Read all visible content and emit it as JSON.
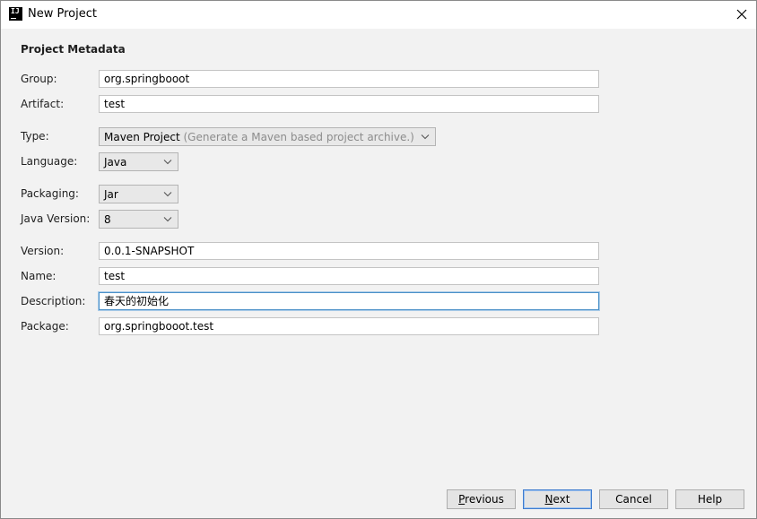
{
  "window": {
    "title": "New Project",
    "app_icon_text": "IJ"
  },
  "form": {
    "section_title": "Project Metadata",
    "group": {
      "label": "Group:",
      "value": "org.springbooot"
    },
    "artifact": {
      "label": "Artifact:",
      "value": "test"
    },
    "type": {
      "label": "Type:",
      "value": "Maven Project",
      "hint": "(Generate a Maven based project archive.)"
    },
    "language": {
      "label": "Language:",
      "value": "Java"
    },
    "packaging": {
      "label": "Packaging:",
      "value": "Jar"
    },
    "java_version": {
      "label": "Java Version:",
      "value": "8"
    },
    "version": {
      "label": "Version:",
      "value": "0.0.1-SNAPSHOT"
    },
    "name": {
      "label": "Name:",
      "value": "test"
    },
    "description": {
      "label": "Description:",
      "value": "春天的初始化"
    },
    "package": {
      "label": "Package:",
      "value": "org.springbooot.test"
    }
  },
  "buttons": {
    "previous": {
      "mnemonic": "P",
      "rest": "revious"
    },
    "next": {
      "mnemonic": "N",
      "rest": "ext"
    },
    "cancel": {
      "label": "Cancel"
    },
    "help": {
      "label": "Help"
    }
  },
  "colors": {
    "focus_border": "#4a90c8",
    "default_button_border": "#3f7ccf"
  },
  "icons": {
    "close": "close-icon",
    "dropdown": "chevron-down-icon"
  }
}
